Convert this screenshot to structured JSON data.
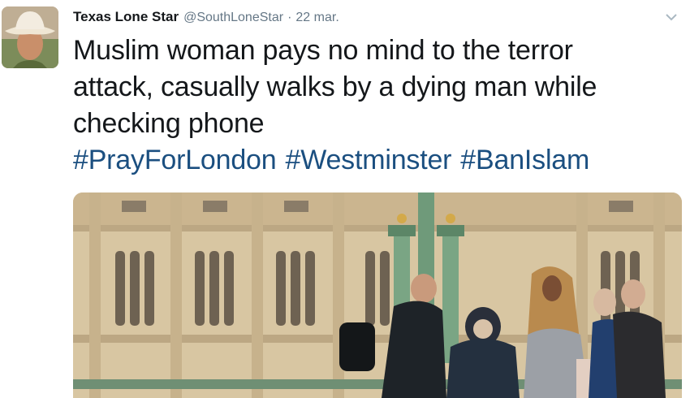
{
  "tweet": {
    "author_name": "Texas Lone Star",
    "author_handle": "@SouthLoneStar",
    "separator": "·",
    "date": "22 mar.",
    "text_lines": [
      "Muslim woman pays no mind to the terror",
      "attack, casually walks by a dying man while",
      "checking phone"
    ],
    "hashtags": [
      "#PrayForLondon",
      "#Westminster",
      "#BanIslam"
    ]
  },
  "icons": {
    "menu": "chevron-down-icon",
    "avatar": "avatar-cowboy-hat"
  },
  "colors": {
    "name": "#14171a",
    "meta": "#657786",
    "hashtag": "#1b4f80"
  }
}
